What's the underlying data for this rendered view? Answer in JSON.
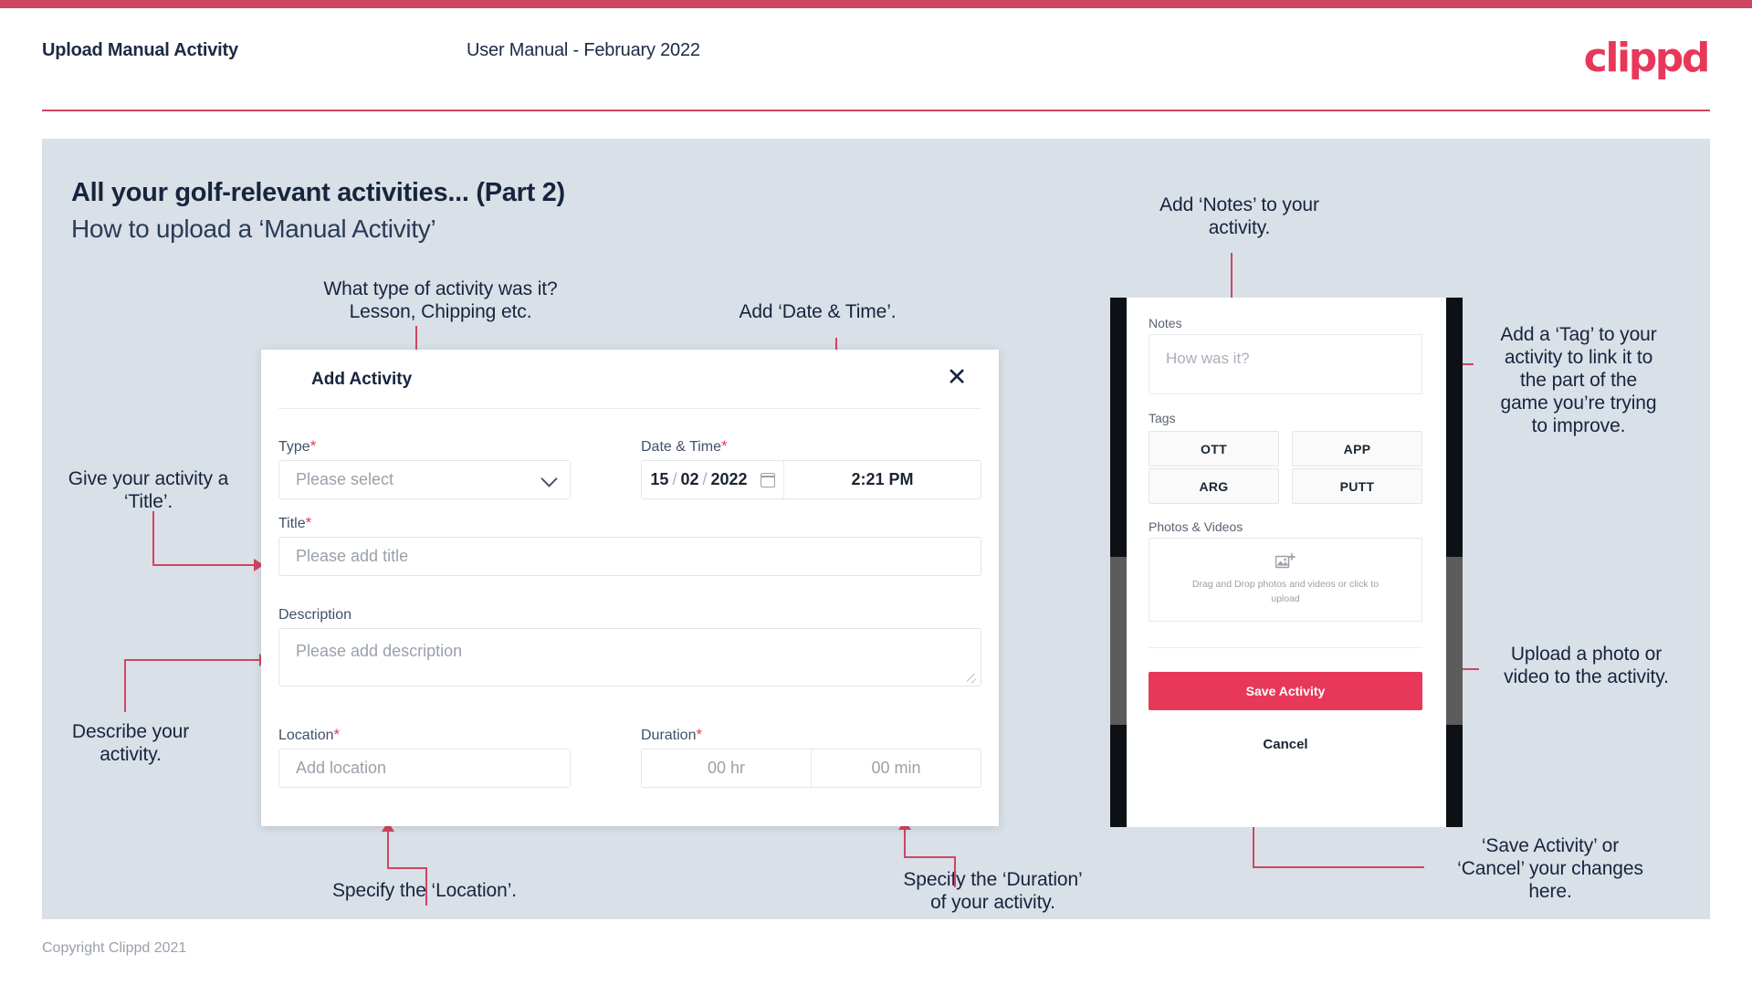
{
  "theme": {
    "accent": "#e8385a",
    "bar": "#cf4661",
    "slide_bg": "#d9e0e8",
    "ink": "#17243d"
  },
  "header": {
    "title": "Upload Manual Activity",
    "subtitle": "User Manual - February 2022",
    "logo": "clippd"
  },
  "slide": {
    "title": "All your golf-relevant activities... (Part 2)",
    "subtitle": "How to upload a ‘Manual Activity’"
  },
  "annotations": {
    "type": "What type of activity was it?\nLesson, Chipping etc.",
    "datetime": "Add ‘Date & Time’.",
    "title": "Give your activity a\n‘Title’.",
    "description": "Describe your\nactivity.",
    "location": "Specify the ‘Location’.",
    "duration": "Specify the ‘Duration’\nof your activity.",
    "notes": "Add ‘Notes’ to your\nactivity.",
    "tags": "Add a ‘Tag’ to your\nactivity to link it to\nthe part of the\ngame you’re trying\nto improve.",
    "photos": "Upload a photo or\nvideo to the activity.",
    "save": "‘Save Activity’ or\n‘Cancel’ your changes\nhere."
  },
  "dialog": {
    "title": "Add Activity",
    "close_icon": "close-icon",
    "fields": {
      "type": {
        "label": "Type",
        "required": "*",
        "placeholder": "Please select",
        "value": ""
      },
      "datetime": {
        "label": "Date & Time",
        "required": "*",
        "day": "15",
        "month": "02",
        "year": "2022",
        "separator": "/",
        "time": "2:21 PM",
        "calendar_icon": "calendar-icon"
      },
      "title": {
        "label": "Title",
        "required": "*",
        "placeholder": "Please add title",
        "value": ""
      },
      "description": {
        "label": "Description",
        "required": "",
        "placeholder": "Please add description",
        "value": ""
      },
      "location": {
        "label": "Location",
        "required": "*",
        "placeholder": "Add location",
        "value": ""
      },
      "duration": {
        "label": "Duration",
        "required": "*",
        "hours_placeholder": "00 hr",
        "minutes_placeholder": "00 min"
      }
    }
  },
  "phone": {
    "notes": {
      "label": "Notes",
      "placeholder": "How was it?"
    },
    "tags": {
      "label": "Tags",
      "items": [
        "OTT",
        "APP",
        "ARG",
        "PUTT"
      ]
    },
    "photos": {
      "label": "Photos & Videos",
      "dropzone_text": "Drag and Drop photos and videos or click to upload",
      "icon": "add-image-icon"
    },
    "save_label": "Save Activity",
    "cancel_label": "Cancel"
  },
  "footer": {
    "copyright": "Copyright Clippd 2021"
  }
}
